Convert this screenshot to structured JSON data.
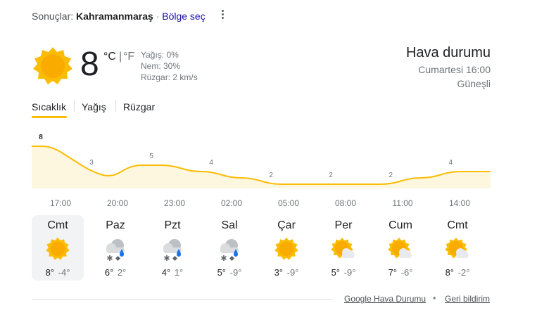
{
  "header": {
    "results_prefix": "Sonuçlar:",
    "location": "Kahramanmaraş",
    "separator": "·",
    "region_link": "Bölge seç"
  },
  "current": {
    "temp": "8",
    "unit_c": "°C",
    "unit_divider": "|",
    "unit_f": "°F",
    "precip": "Yağış: 0%",
    "humidity": "Nem: 30%",
    "wind": "Rüzgar: 2 km/s",
    "icon": "sunny-icon"
  },
  "summary": {
    "title": "Hava durumu",
    "day_time": "Cumartesi 16:00",
    "condition": "Güneşli"
  },
  "tabs": [
    {
      "label": "Sıcaklık",
      "selected": true
    },
    {
      "label": "Yağış",
      "selected": false
    },
    {
      "label": "Rüzgar",
      "selected": false
    }
  ],
  "chart_data": {
    "type": "area",
    "x": [
      "16:00",
      "17:00",
      "18:00",
      "19:00",
      "20:00",
      "21:00",
      "22:00",
      "23:00",
      "00:00",
      "01:00",
      "02:00",
      "03:00",
      "04:00",
      "05:00",
      "06:00",
      "07:00",
      "08:00",
      "09:00",
      "10:00",
      "11:00",
      "12:00",
      "13:00",
      "14:00",
      "15:00"
    ],
    "values": [
      8,
      8,
      6,
      4,
      3,
      5,
      5,
      5,
      4,
      4,
      3,
      3,
      2,
      2,
      2,
      2,
      2,
      2,
      2,
      3,
      3,
      4,
      4,
      4
    ],
    "labels": [
      {
        "index": 0,
        "text": "8"
      },
      {
        "index": 3,
        "text": "3"
      },
      {
        "index": 6,
        "text": "5"
      },
      {
        "index": 9,
        "text": "4"
      },
      {
        "index": 12,
        "text": "2"
      },
      {
        "index": 15,
        "text": "2"
      },
      {
        "index": 18,
        "text": "2"
      },
      {
        "index": 21,
        "text": "4"
      }
    ],
    "hour_ticks": [
      "17:00",
      "20:00",
      "23:00",
      "02:00",
      "05:00",
      "08:00",
      "11:00",
      "14:00"
    ],
    "line_color": "#fbbc04",
    "fill_color": "#fef7e0"
  },
  "days": [
    {
      "name": "Cmt",
      "icon": "sunny-icon",
      "high": "8°",
      "low": "-4°",
      "selected": true
    },
    {
      "name": "Paz",
      "icon": "snow-rain-icon",
      "high": "6°",
      "low": "2°",
      "selected": false
    },
    {
      "name": "Pzt",
      "icon": "snow-rain-icon",
      "high": "4°",
      "low": "1°",
      "selected": false
    },
    {
      "name": "Sal",
      "icon": "snow-rain-icon",
      "high": "5°",
      "low": "-9°",
      "selected": false
    },
    {
      "name": "Çar",
      "icon": "sunny-icon",
      "high": "3°",
      "low": "-9°",
      "selected": false
    },
    {
      "name": "Per",
      "icon": "partly-cloudy-icon",
      "high": "5°",
      "low": "-9°",
      "selected": false
    },
    {
      "name": "Cum",
      "icon": "partly-cloudy-icon",
      "high": "7°",
      "low": "-6°",
      "selected": false
    },
    {
      "name": "Cmt",
      "icon": "partly-cloudy-icon",
      "high": "8°",
      "low": "-2°",
      "selected": false
    }
  ],
  "footer": {
    "source_link": "Google Hava Durumu",
    "dot": "•",
    "feedback_link": "Geri bildirim"
  }
}
